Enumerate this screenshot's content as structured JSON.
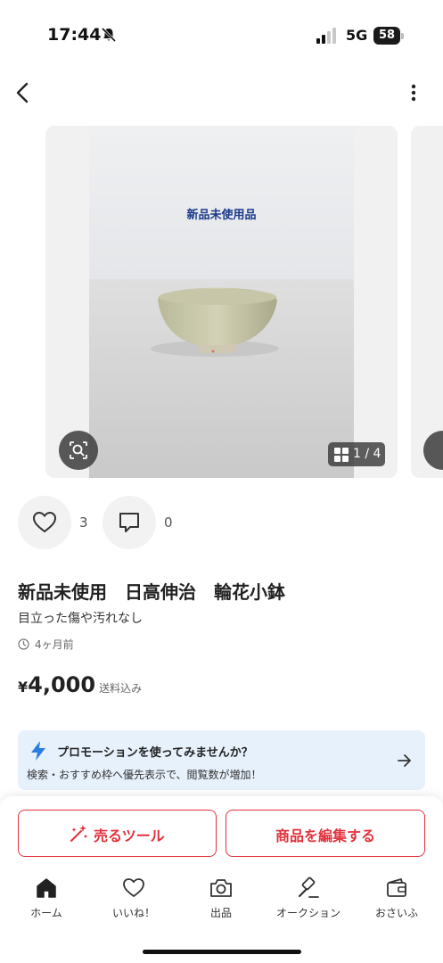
{
  "status_bar": {
    "time": "17:44",
    "network": "5G",
    "battery": "58",
    "icons": [
      "bell-slash-icon",
      "signal-icon",
      "battery-icon"
    ]
  },
  "nav": {
    "icons": [
      "chevron-left-icon",
      "more-vertical-icon"
    ]
  },
  "gallery": {
    "photo_caption": "新品未使用品",
    "counter": "1 / 4",
    "icons": [
      "image-search-icon",
      "grid-icon"
    ]
  },
  "engagement": {
    "likes": "3",
    "comments": "0",
    "icons": [
      "heart-icon",
      "comment-icon"
    ]
  },
  "product": {
    "title": "新品未使用　日高伸治　輪花小鉢",
    "subtitle": "目立った傷や汚れなし",
    "posted": "4ヶ月前",
    "price_symbol": "¥",
    "price": "4,000",
    "shipping": "送料込み"
  },
  "promo": {
    "title": "プロモーションを使ってみませんか？",
    "description": "検索・おすすめ枠へ優先表示で、閲覧数が増加！",
    "icons": [
      "lightning-icon",
      "arrow-right-icon"
    ]
  },
  "actions": {
    "sell_tools": "売るツール",
    "edit_item": "商品を編集する"
  },
  "tab_bar": [
    {
      "label": "ホーム",
      "icon": "home-icon"
    },
    {
      "label": "いいね！",
      "icon": "heart-icon"
    },
    {
      "label": "出品",
      "icon": "camera-icon"
    },
    {
      "label": "オークション",
      "icon": "gavel-icon"
    },
    {
      "label": "おさいふ",
      "icon": "wallet-icon"
    }
  ],
  "colors": {
    "accent_red": "#e2313b",
    "promo_bg": "#e7f1fb",
    "promo_bolt": "#2a7de1",
    "caption_blue": "#1b3a8a"
  }
}
